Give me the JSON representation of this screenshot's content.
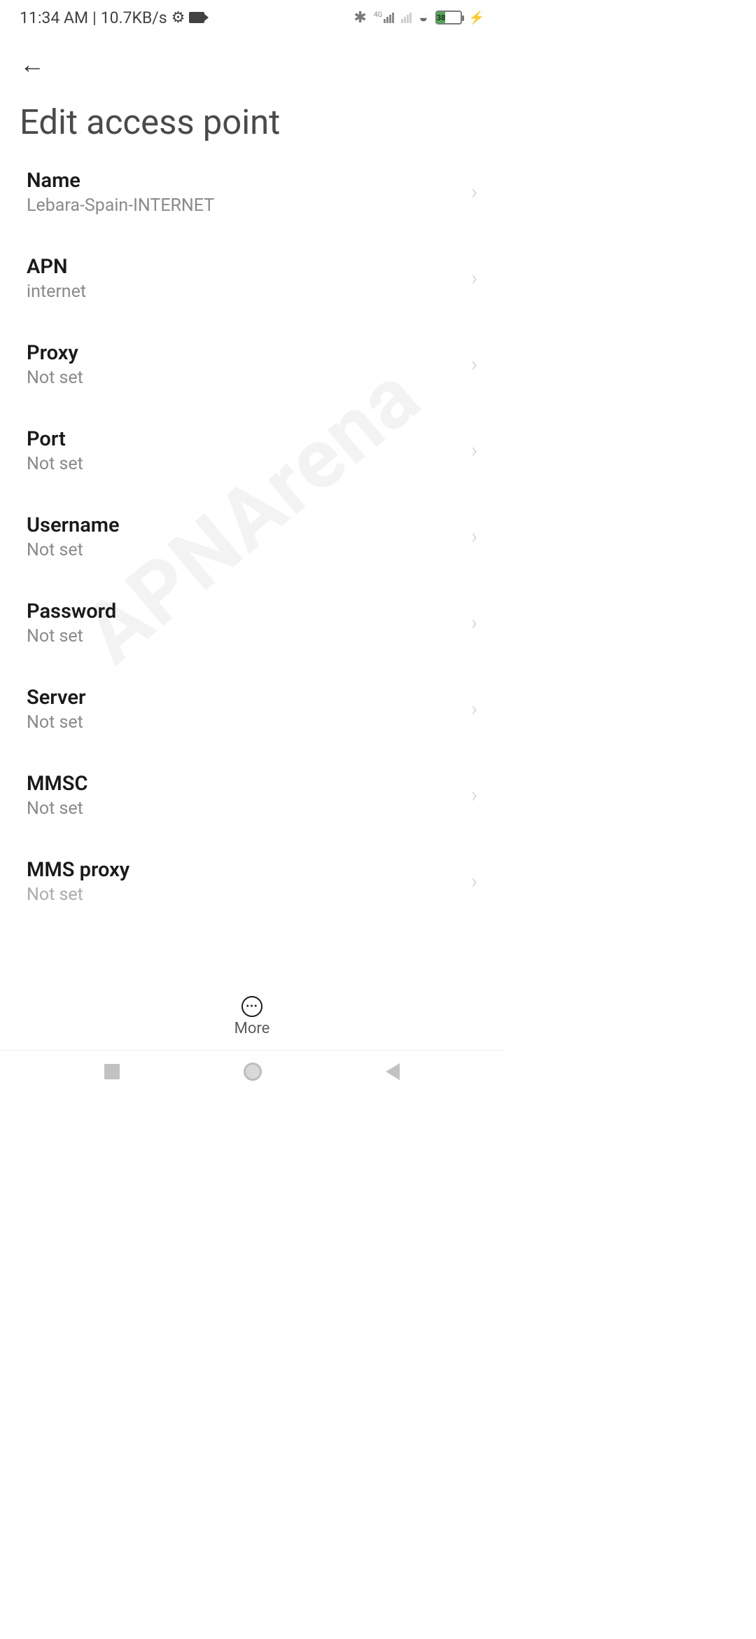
{
  "status": {
    "time": "11:34 AM",
    "separator": "|",
    "data_rate": "10.7KB/s",
    "network_label": "4G",
    "battery_percent": "38",
    "battery_fill_width": "38%"
  },
  "header": {
    "title": "Edit access point"
  },
  "items": [
    {
      "title": "Name",
      "value": "Lebara-Spain-INTERNET",
      "name": "setting-name"
    },
    {
      "title": "APN",
      "value": "internet",
      "name": "setting-apn"
    },
    {
      "title": "Proxy",
      "value": "Not set",
      "name": "setting-proxy"
    },
    {
      "title": "Port",
      "value": "Not set",
      "name": "setting-port"
    },
    {
      "title": "Username",
      "value": "Not set",
      "name": "setting-username"
    },
    {
      "title": "Password",
      "value": "Not set",
      "name": "setting-password"
    },
    {
      "title": "Server",
      "value": "Not set",
      "name": "setting-server"
    },
    {
      "title": "MMSC",
      "value": "Not set",
      "name": "setting-mmsc"
    },
    {
      "title": "MMS proxy",
      "value": "Not set",
      "name": "setting-mms-proxy"
    }
  ],
  "footer": {
    "more_label": "More"
  },
  "watermark": "APNArena"
}
